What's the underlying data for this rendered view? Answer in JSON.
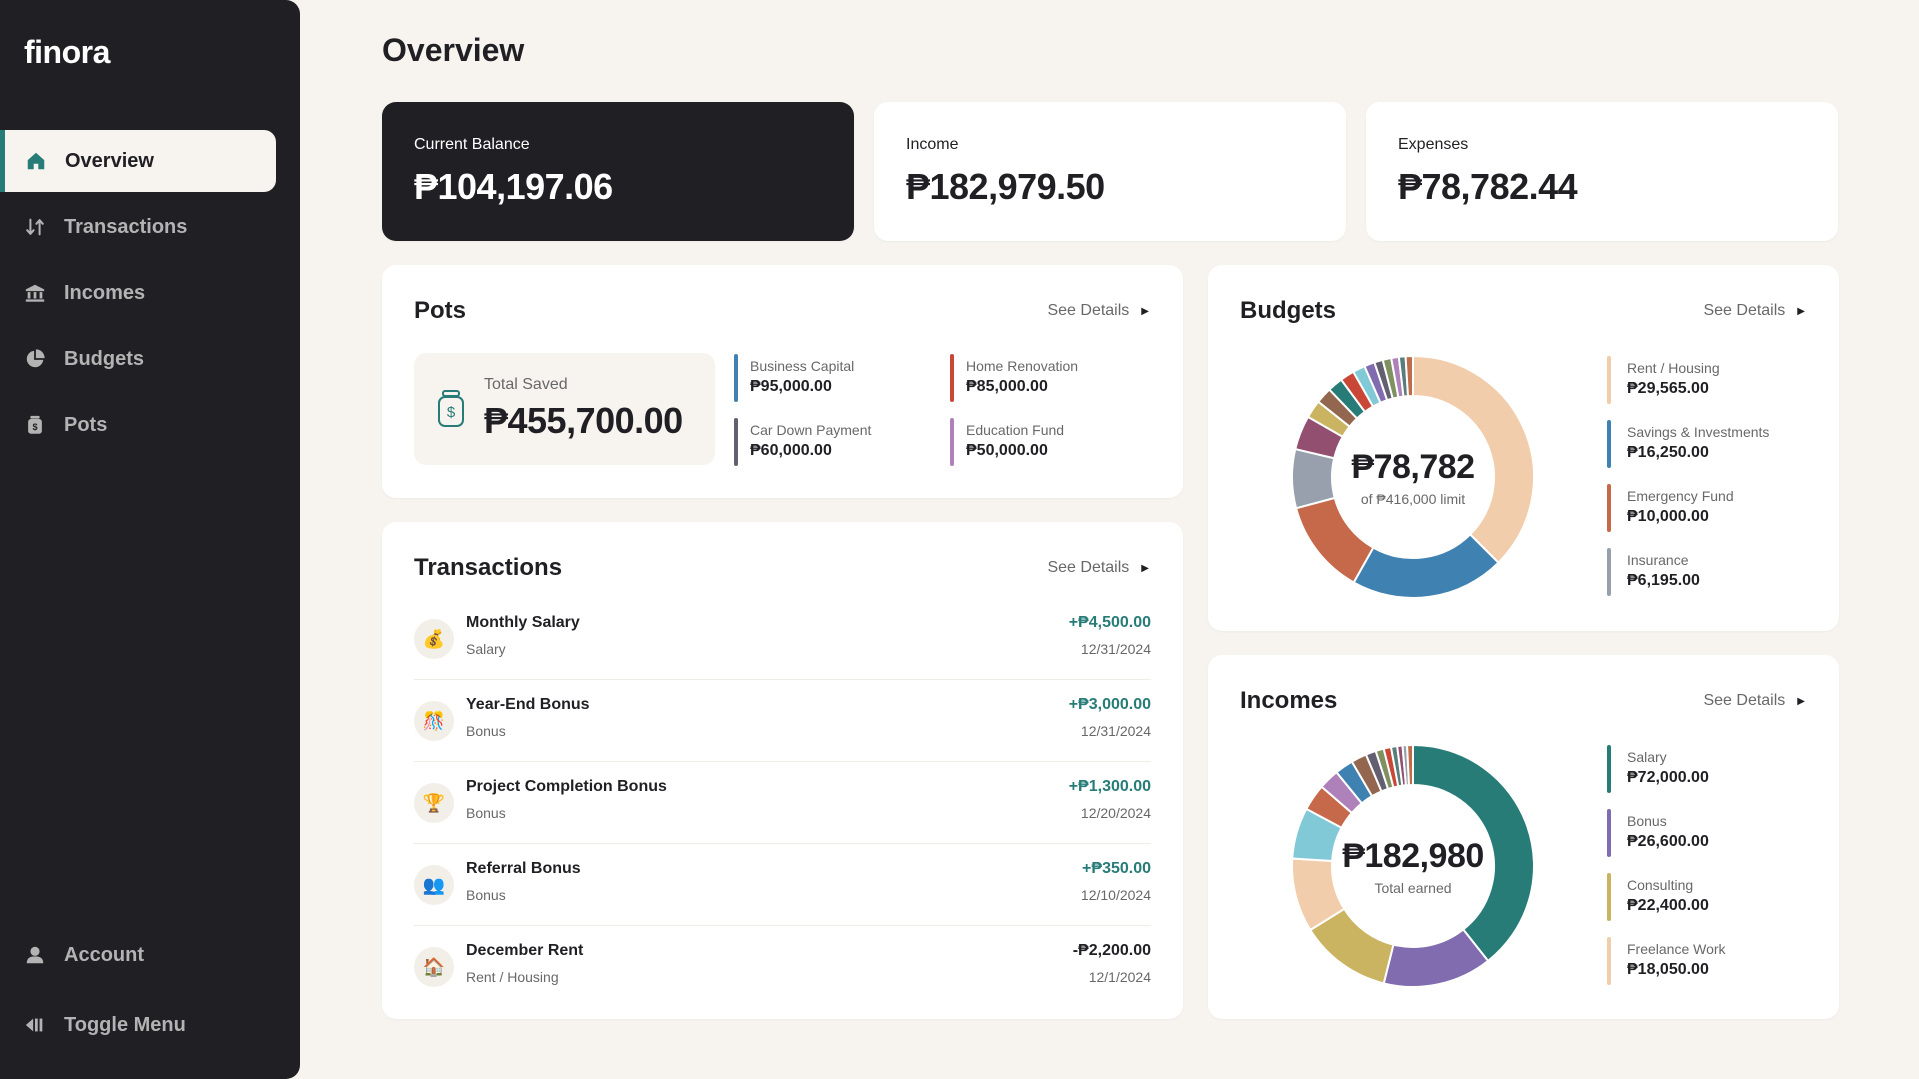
{
  "app": {
    "logo": "finora"
  },
  "sidebar": {
    "items": [
      {
        "label": "Overview",
        "icon": "home-icon"
      },
      {
        "label": "Transactions",
        "icon": "arrows-updown-icon"
      },
      {
        "label": "Incomes",
        "icon": "bank-icon"
      },
      {
        "label": "Budgets",
        "icon": "pie-chart-icon"
      },
      {
        "label": "Pots",
        "icon": "money-jar-icon"
      }
    ],
    "account_label": "Account",
    "toggle_label": "Toggle Menu"
  },
  "page": {
    "title": "Overview"
  },
  "stats": {
    "balance": {
      "label": "Current Balance",
      "value": "₱104,197.06"
    },
    "income": {
      "label": "Income",
      "value": "₱182,979.50"
    },
    "expenses": {
      "label": "Expenses",
      "value": "₱78,782.44"
    }
  },
  "pots": {
    "title": "Pots",
    "see_details": "See Details",
    "total_label": "Total Saved",
    "total_value": "₱455,700.00",
    "items": [
      {
        "name": "Business Capital",
        "amount": "₱95,000.00",
        "color": "#3f82b2"
      },
      {
        "name": "Home Renovation",
        "amount": "₱85,000.00",
        "color": "#c94736"
      },
      {
        "name": "Car Down Payment",
        "amount": "₱60,000.00",
        "color": "#626070"
      },
      {
        "name": "Education Fund",
        "amount": "₱50,000.00",
        "color": "#af81ba"
      }
    ]
  },
  "transactions": {
    "title": "Transactions",
    "see_details": "See Details",
    "items": [
      {
        "name": "Monthly Salary",
        "category": "Salary",
        "amount": "+₱4,500.00",
        "date": "12/31/2024",
        "emoji": "💰"
      },
      {
        "name": "Year-End Bonus",
        "category": "Bonus",
        "amount": "+₱3,000.00",
        "date": "12/31/2024",
        "emoji": "🎊"
      },
      {
        "name": "Project Completion Bonus",
        "category": "Bonus",
        "amount": "+₱1,300.00",
        "date": "12/20/2024",
        "emoji": "🏆"
      },
      {
        "name": "Referral Bonus",
        "category": "Bonus",
        "amount": "+₱350.00",
        "date": "12/10/2024",
        "emoji": "👥"
      },
      {
        "name": "December Rent",
        "category": "Rent / Housing",
        "amount": "-₱2,200.00",
        "date": "12/1/2024",
        "emoji": "🏠"
      }
    ]
  },
  "budgets": {
    "title": "Budgets",
    "see_details": "See Details",
    "center_value": "₱78,782",
    "center_label": "of ₱416,000 limit",
    "legend": [
      {
        "name": "Rent / Housing",
        "amount": "₱29,565.00",
        "color": "#f2cdac"
      },
      {
        "name": "Savings & Investments",
        "amount": "₱16,250.00",
        "color": "#3f82b2"
      },
      {
        "name": "Emergency Fund",
        "amount": "₱10,000.00",
        "color": "#c5694a"
      },
      {
        "name": "Insurance",
        "amount": "₱6,195.00",
        "color": "#97a0ac"
      }
    ],
    "segments": [
      {
        "value": 29565,
        "color": "#f2cdac"
      },
      {
        "value": 16250,
        "color": "#3f82b2"
      },
      {
        "value": 10000,
        "color": "#c5694a"
      },
      {
        "value": 6195,
        "color": "#97a0ac"
      },
      {
        "value": 3600,
        "color": "#934f6f"
      },
      {
        "value": 1900,
        "color": "#cab361"
      },
      {
        "value": 1700,
        "color": "#93674f"
      },
      {
        "value": 1600,
        "color": "#277c78"
      },
      {
        "value": 1500,
        "color": "#c94736"
      },
      {
        "value": 1300,
        "color": "#82c9d7"
      },
      {
        "value": 1100,
        "color": "#826cb0"
      },
      {
        "value": 900,
        "color": "#626070"
      },
      {
        "value": 900,
        "color": "#7f9161"
      },
      {
        "value": 800,
        "color": "#af81ba"
      },
      {
        "value": 700,
        "color": "#597c7c"
      },
      {
        "value": 772,
        "color": "#be6c49"
      }
    ]
  },
  "incomes": {
    "title": "Incomes",
    "see_details": "See Details",
    "center_value": "₱182,980",
    "center_label": "Total earned",
    "legend": [
      {
        "name": "Salary",
        "amount": "₱72,000.00",
        "color": "#277c78"
      },
      {
        "name": "Bonus",
        "amount": "₱26,600.00",
        "color": "#826cb0"
      },
      {
        "name": "Consulting",
        "amount": "₱22,400.00",
        "color": "#cab361"
      },
      {
        "name": "Freelance Work",
        "amount": "₱18,050.00",
        "color": "#f2cdac"
      }
    ],
    "segments": [
      {
        "value": 72000,
        "color": "#277c78"
      },
      {
        "value": 26600,
        "color": "#826cb0"
      },
      {
        "value": 22400,
        "color": "#cab361"
      },
      {
        "value": 18050,
        "color": "#f2cdac"
      },
      {
        "value": 12500,
        "color": "#82c9d7"
      },
      {
        "value": 6500,
        "color": "#c5694a"
      },
      {
        "value": 5000,
        "color": "#af81ba"
      },
      {
        "value": 4500,
        "color": "#3f82b2"
      },
      {
        "value": 3800,
        "color": "#93674f"
      },
      {
        "value": 2500,
        "color": "#626070"
      },
      {
        "value": 2000,
        "color": "#7f9161"
      },
      {
        "value": 1800,
        "color": "#c94736"
      },
      {
        "value": 1500,
        "color": "#597c7c"
      },
      {
        "value": 1300,
        "color": "#934f6f"
      },
      {
        "value": 1100,
        "color": "#97a0ac"
      },
      {
        "value": 1430,
        "color": "#be6c49"
      }
    ]
  }
}
